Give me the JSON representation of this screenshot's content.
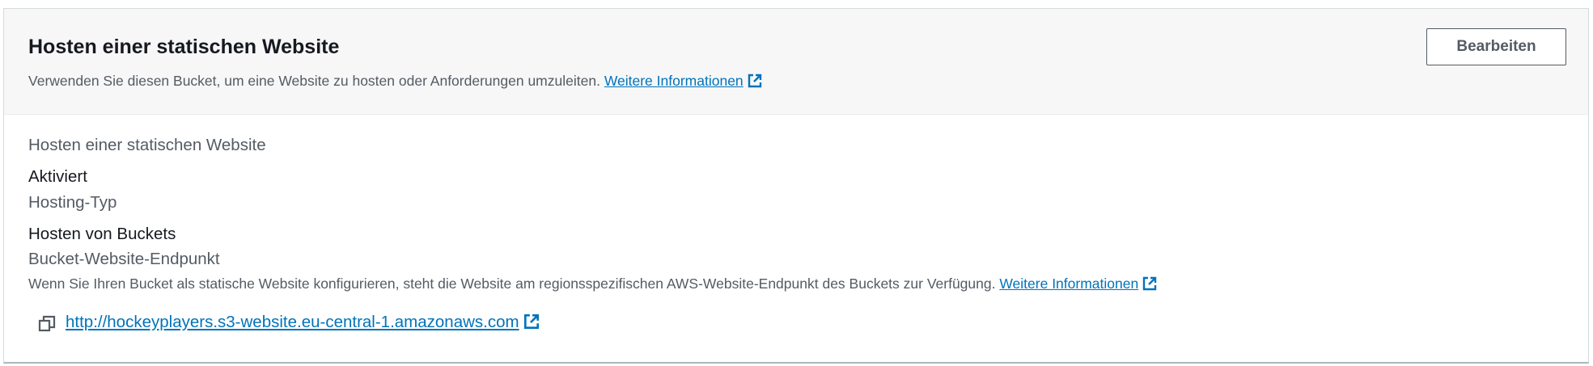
{
  "header": {
    "title": "Hosten einer statischen Website",
    "description": "Verwenden Sie diesen Bucket, um eine Website zu hosten oder Anforderungen umzuleiten.",
    "learn_more": "Weitere Informationen",
    "edit_button": "Bearbeiten"
  },
  "details": {
    "hosting_label": "Hosten einer statischen Website",
    "hosting_value": "Aktiviert",
    "type_label": "Hosting-Typ",
    "type_value": "Hosten von Buckets",
    "endpoint_label": "Bucket-Website-Endpunkt",
    "endpoint_hint": "Wenn Sie Ihren Bucket als statische Website konfigurieren, steht die Website am regionsspezifischen AWS-Website-Endpunkt des Buckets zur Verfügung.",
    "endpoint_learn_more": "Weitere Informationen",
    "endpoint_url": "http://hockeyplayers.s3-website.eu-central-1.amazonaws.com"
  },
  "icons": {
    "external": "external-link-icon",
    "copy": "copy-icon"
  },
  "colors": {
    "link": "#0073bb",
    "header_bg": "#f7f7f7",
    "text_primary": "#16191f",
    "text_secondary": "#545b64"
  }
}
